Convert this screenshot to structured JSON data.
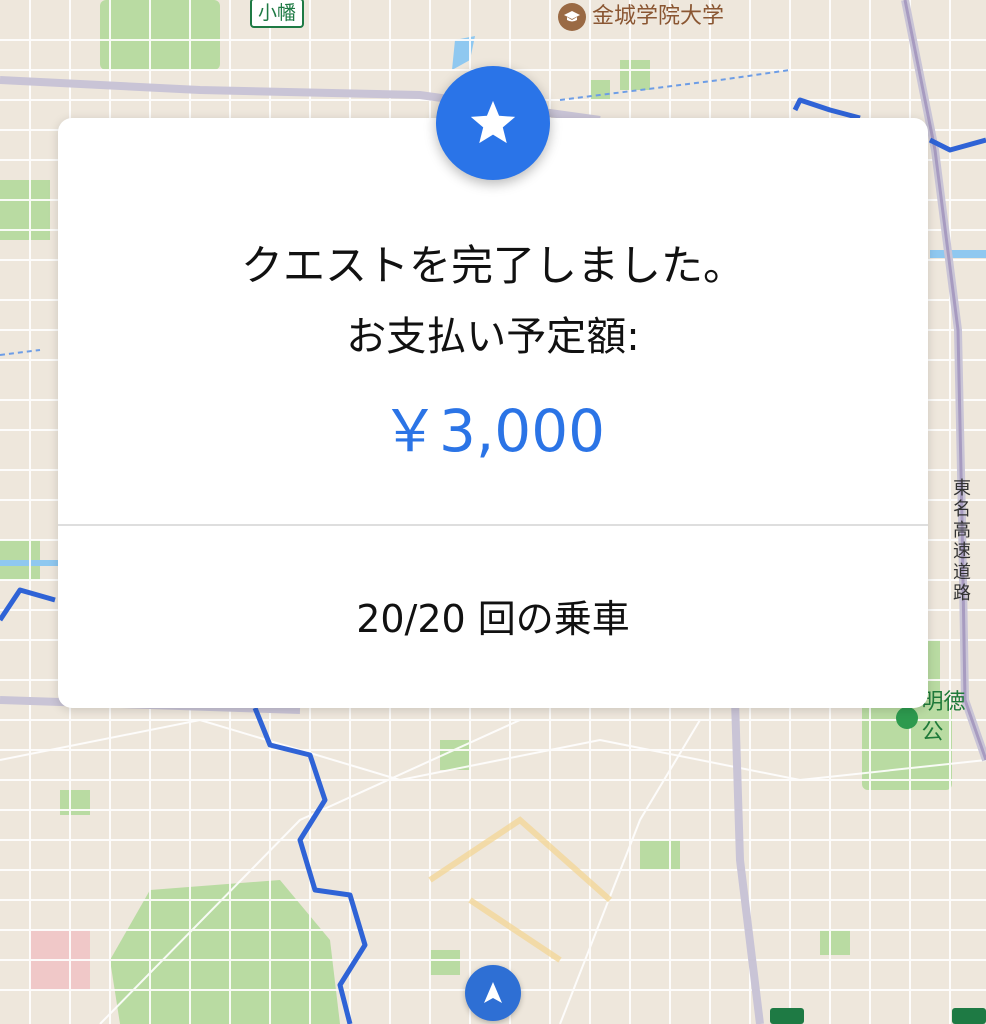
{
  "map": {
    "labels": {
      "kobata": "小幡",
      "kinjo_university": "金城学院大学",
      "tomei_expressway": "東名高速道路",
      "meitoku_park": "明徳公"
    },
    "icons": {
      "university": "graduation-cap-icon",
      "park": "park-icon",
      "navigation": "navigation-arrow-icon"
    }
  },
  "modal": {
    "icon": "star-icon",
    "title": "クエストを完了しました。",
    "subtitle": "お支払い予定額:",
    "amount": "￥3,000",
    "rides": "20/20 回の乗車"
  },
  "colors": {
    "accent": "#2b74e6",
    "star_badge": "#2a74e8",
    "route": "#2f63d6",
    "park": "#b8dca0",
    "map_bg": "#eee7dc"
  }
}
